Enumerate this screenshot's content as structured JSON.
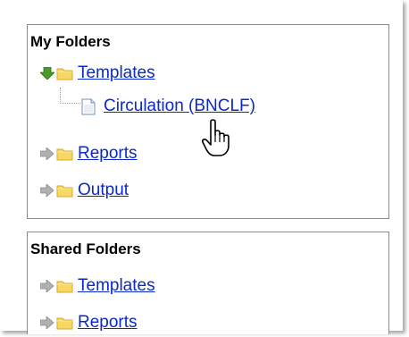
{
  "my_folders": {
    "title": "My Folders",
    "items": [
      {
        "label": "Templates",
        "icon": "green-arrow-down-icon",
        "expanded": true
      },
      {
        "label": "Circulation (BNCLF)",
        "icon": "document-icon"
      },
      {
        "label": "Reports",
        "icon": "gray-arrow-right-icon"
      },
      {
        "label": "Output",
        "icon": "gray-arrow-right-icon"
      }
    ]
  },
  "shared_folders": {
    "title": "Shared Folders",
    "items": [
      {
        "label": "Templates",
        "icon": "gray-arrow-right-icon"
      },
      {
        "label": "Reports",
        "icon": "gray-arrow-right-icon"
      }
    ]
  },
  "colors": {
    "link": "#0b29c9",
    "expanded_arrow": "#4a9a2a",
    "collapsed_arrow": "#b0b0b0",
    "folder": "#f7d865"
  },
  "cursor": "hand-pointer-icon"
}
